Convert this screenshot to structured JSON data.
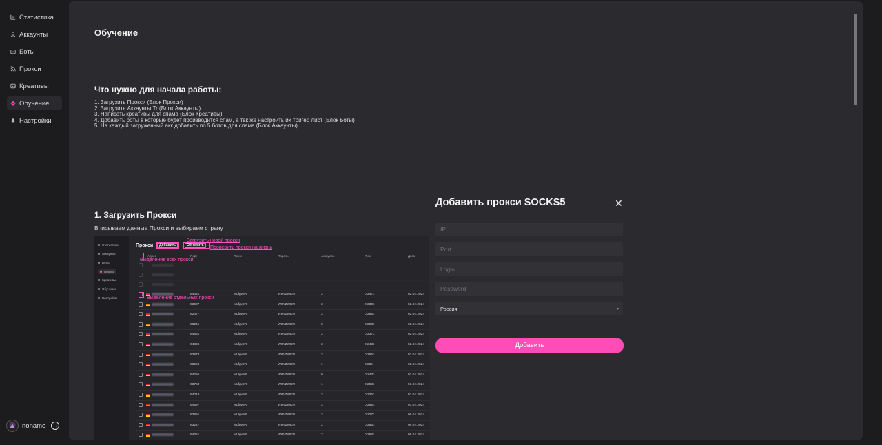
{
  "sidebar": {
    "items": [
      {
        "label": "Статистика",
        "icon": "chart-icon"
      },
      {
        "label": "Аккаунты",
        "icon": "user-icon"
      },
      {
        "label": "Боты",
        "icon": "bot-icon"
      },
      {
        "label": "Прокси",
        "icon": "rss-icon"
      },
      {
        "label": "Креативы",
        "icon": "image-icon"
      },
      {
        "label": "Обучение",
        "icon": "gear-icon",
        "active": true
      },
      {
        "label": "Настройки",
        "icon": "bell-icon"
      }
    ],
    "user": {
      "name": "noname"
    }
  },
  "main": {
    "title": "Обучение",
    "section1": {
      "heading": "Что нужно для начала работы:",
      "steps": [
        "1. Загрузить Прокси (Блок Прокси)",
        "2. Загрузить Аккаунты Tr (Блок Аккаунты)",
        "3. Написать креативы для спама (Блок Креативы)",
        "4. Добавить боты в которые будет производится спам, а так же настроить их тригер лист (Блок Боты)",
        "5. На каждый загруженный акк добавить по 5 ботов для спама (Блок Аккаунты)"
      ]
    },
    "section2": {
      "heading": "1. Загрузить Прокси",
      "description": "Вписываем данные Прокси и выбираем страну"
    }
  },
  "screenshot": {
    "nav": [
      "Статистика",
      "Аккаунты",
      "Боты",
      "Прокси",
      "Креативы",
      "Обучение",
      "Настройки"
    ],
    "title": "Прокси",
    "add_btn": "Добавить",
    "refresh_btn": "Обновить",
    "annotations": {
      "upload_new": "Загрузить новой прокси",
      "check_proxy": "Проверить прокси на жизнь",
      "select_all": "Выделение всех прокси",
      "select_one": "Выделение отдельных прокси"
    },
    "columns": [
      "Адрес",
      "Порт",
      "Логин",
      "Пароль",
      "Аккаунты",
      "Пинг",
      "Дата"
    ],
    "rows": [
      {
        "port": "64431",
        "login": "MLfgv9R",
        "pass": "W8NZWKN",
        "acc": "3",
        "ping": "0.247c",
        "date": "02.04.2024"
      },
      {
        "port": "63637",
        "login": "MLfgv9R",
        "pass": "W8NZWKN",
        "acc": "3",
        "ping": "0.330c",
        "date": "02.04.2024"
      },
      {
        "port": "62477",
        "login": "MLfgv9R",
        "pass": "W8NZWKN",
        "acc": "3",
        "ping": "0.286c",
        "date": "02.04.2024"
      },
      {
        "port": "63241",
        "login": "MLfgv9R",
        "pass": "W8NZWKN",
        "acc": "0",
        "ping": "0.298c",
        "date": "02.04.2024"
      },
      {
        "port": "64831",
        "login": "MLfgv9R",
        "pass": "W8NZWKN",
        "acc": "3",
        "ping": "0.237c",
        "date": "02.04.2024"
      },
      {
        "port": "64898",
        "login": "MLfgv9R",
        "pass": "W8NZWKN",
        "acc": "3",
        "ping": "0.243c",
        "date": "02.04.2024"
      },
      {
        "port": "63873",
        "login": "MLfgv9R",
        "pass": "W8NZWKN",
        "acc": "3",
        "ping": "0.265c",
        "date": "02.04.2024"
      },
      {
        "port": "63598",
        "login": "MLfgv9R",
        "pass": "W8NZWKN",
        "acc": "1",
        "ping": "0.23c",
        "date": "02.04.2024"
      },
      {
        "port": "64295",
        "login": "MLfgv9R",
        "pass": "W8NZWKN",
        "acc": "0",
        "ping": "0.243c",
        "date": "02.04.2024"
      },
      {
        "port": "63763",
        "login": "MLfgv9R",
        "pass": "W8NZWKN",
        "acc": "1",
        "ping": "0.258c",
        "date": "03.04.2024"
      },
      {
        "port": "64019",
        "login": "MLfgv9R",
        "pass": "W8NZWKN",
        "acc": "3",
        "ping": "0.225c",
        "date": "03.04.2024"
      },
      {
        "port": "64697",
        "login": "MLfgv9R",
        "pass": "W8NZWKN",
        "acc": "3",
        "ping": "0.258c",
        "date": "03.04.2024"
      },
      {
        "port": "63891",
        "login": "MLfgv9R",
        "pass": "W8NZWKN",
        "acc": "3",
        "ping": "0.227c",
        "date": "06.04.2024"
      },
      {
        "port": "63247",
        "login": "MLfgv9R",
        "pass": "W8NZWKN",
        "acc": "2",
        "ping": "0.256c",
        "date": "06.04.2024"
      },
      {
        "port": "64351",
        "login": "MLfgv9R",
        "pass": "W8NZWKN",
        "acc": "2",
        "ping": "0.268c",
        "date": "06.04.2024"
      }
    ]
  },
  "modal": {
    "title": "Добавить прокси SOCKS5",
    "ip_placeholder": "IP",
    "port_placeholder": "Port",
    "login_placeholder": "Login",
    "password_placeholder": "Password",
    "country": "Россия",
    "submit": "Добавить"
  },
  "colors": {
    "accent": "#ff4db8",
    "annotation": "#ff4fc0",
    "panel": "#2b2b2f",
    "background": "#1c1c1f"
  }
}
